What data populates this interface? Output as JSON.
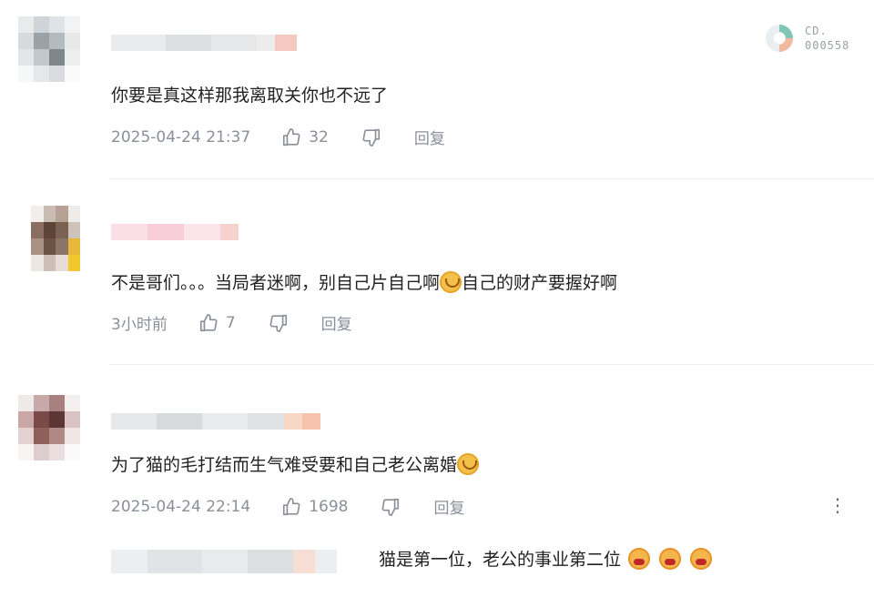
{
  "watermark": {
    "line1": "CD.",
    "line2": "000558"
  },
  "comments": [
    {
      "text": "你要是真这样那我离取关你也不远了",
      "time": "2025-04-24 21:37",
      "likes": "32",
      "reply_label": "回复"
    },
    {
      "text_before": "不是哥们。。。当局者迷啊，别自己片自己啊",
      "text_after": "自己的财产要握好啊",
      "time": "3小时前",
      "likes": "7",
      "reply_label": "回复"
    },
    {
      "text": "为了猫的毛打结而生气难受要和自己老公离婚",
      "time": "2025-04-24 22:14",
      "likes": "1698",
      "reply_label": "回复",
      "more_label": "⋮"
    }
  ],
  "sub_reply": {
    "text": "猫是第一位，老公的事业第二位"
  },
  "icons": [
    "thumb-up-icon",
    "thumb-down-icon",
    "wry-smile-emoji",
    "angry-emoji",
    "more-vertical-icon",
    "watermark-logo-icon"
  ],
  "colors": {
    "meta_text": "#8a8f99",
    "divider": "#eeeeee",
    "body_text": "#222222"
  }
}
